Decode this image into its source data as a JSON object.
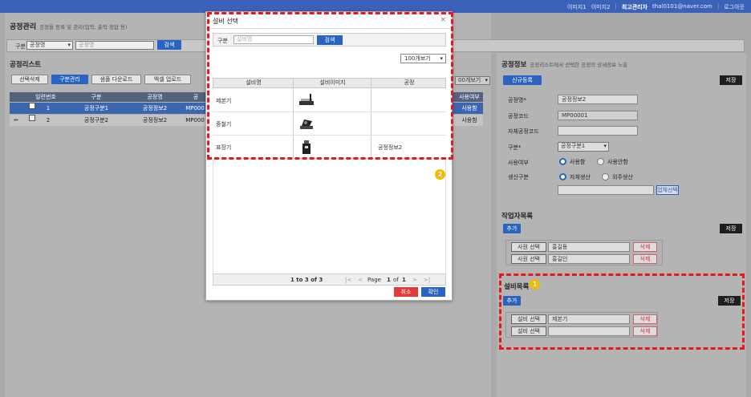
{
  "topbar": {
    "img1": "이미지1",
    "img2": "이미지2",
    "admin_role": "최고관리자",
    "admin_email": "thal0101@naver.com",
    "logout": "로그아웃"
  },
  "page": {
    "title": "공정관리",
    "subtitle": "공정을 등록 및 관리(입력, 출력 정합 용)"
  },
  "filter": {
    "label": "구분",
    "select_value": "공정명",
    "input_placeholder": "공정명",
    "search_label": "검색"
  },
  "process_list": {
    "title": "공정리스트",
    "buttons": [
      "선택삭제",
      "구분관리",
      "샘플 다운로드",
      "엑셀 업로드"
    ],
    "page_size": "00개보기",
    "columns": [
      "일련번호",
      "구분",
      "공정명",
      "공",
      "사용여부"
    ],
    "rows": [
      {
        "no": "1",
        "type": "공정구분1",
        "name": "공정정보2",
        "code": "MP000",
        "use": "사용함",
        "selected": true
      },
      {
        "no": "2",
        "type": "공정구분2",
        "name": "공정정보2",
        "code": "MP000",
        "use": "사용함",
        "selected": false
      }
    ],
    "row_edit_icon": "✏"
  },
  "process_info": {
    "title": "공정정보",
    "subtitle": "공정리스트에서 선택한 공정의 상세정보 노출",
    "new_label": "신규등록",
    "save_label": "저장",
    "fields": {
      "name_label": "공정명*",
      "name_value": "공정정보2",
      "code_label": "공정코드",
      "code_value": "MP00001",
      "own_code_label": "자체공정코드",
      "own_code_value": "",
      "type_label": "구분*",
      "type_value": "공정구분1",
      "use_label": "사용여부",
      "use_yes": "사용함",
      "use_no": "사용안함",
      "prod_label": "생산구분",
      "prod_own": "자체생산",
      "prod_out": "외주생산",
      "vendor_value": "",
      "vendor_button": "업체선택"
    }
  },
  "workers": {
    "title": "작업자목록",
    "add_label": "추가",
    "save_label": "저장",
    "rows": [
      {
        "pick": "사원 선택",
        "name": "홍길동",
        "del": "삭제"
      },
      {
        "pick": "사원 선택",
        "name": "홍길인",
        "del": "삭제"
      }
    ]
  },
  "equipment_list": {
    "title": "설비목록",
    "add_label": "추가",
    "save_label": "저장",
    "rows": [
      {
        "pick": "설비 선택",
        "name": "제본기",
        "del": "삭제"
      },
      {
        "pick": "설비 선택",
        "name": "",
        "del": "삭제"
      }
    ]
  },
  "badges": [
    "1",
    "2"
  ],
  "modal": {
    "title": "설비 선택",
    "close": "×",
    "search_label": "구분",
    "search_placeholder": "설비명",
    "search_button": "검색",
    "page_size": "100개보기",
    "columns": [
      "설비명",
      "설비이미지",
      "공정"
    ],
    "rows": [
      {
        "name": "제본기",
        "icon": "binding-machine-icon",
        "process": ""
      },
      {
        "name": "중철기",
        "icon": "stapler-machine-icon",
        "process": ""
      },
      {
        "name": "표장기",
        "icon": "packing-machine-icon",
        "process": "공정정보2"
      }
    ],
    "pager": {
      "range": "1 to 3 of 3",
      "first": "|<",
      "prev": "<",
      "page_prefix": "Page",
      "page_num": "1",
      "of": "of",
      "page_total": "1",
      "next": ">",
      "last": ">|"
    },
    "cancel": "취소",
    "confirm": "확인"
  },
  "colors": {
    "accent": "#2a63c2",
    "highlight": "#e8171b",
    "badge": "#f5b800"
  }
}
